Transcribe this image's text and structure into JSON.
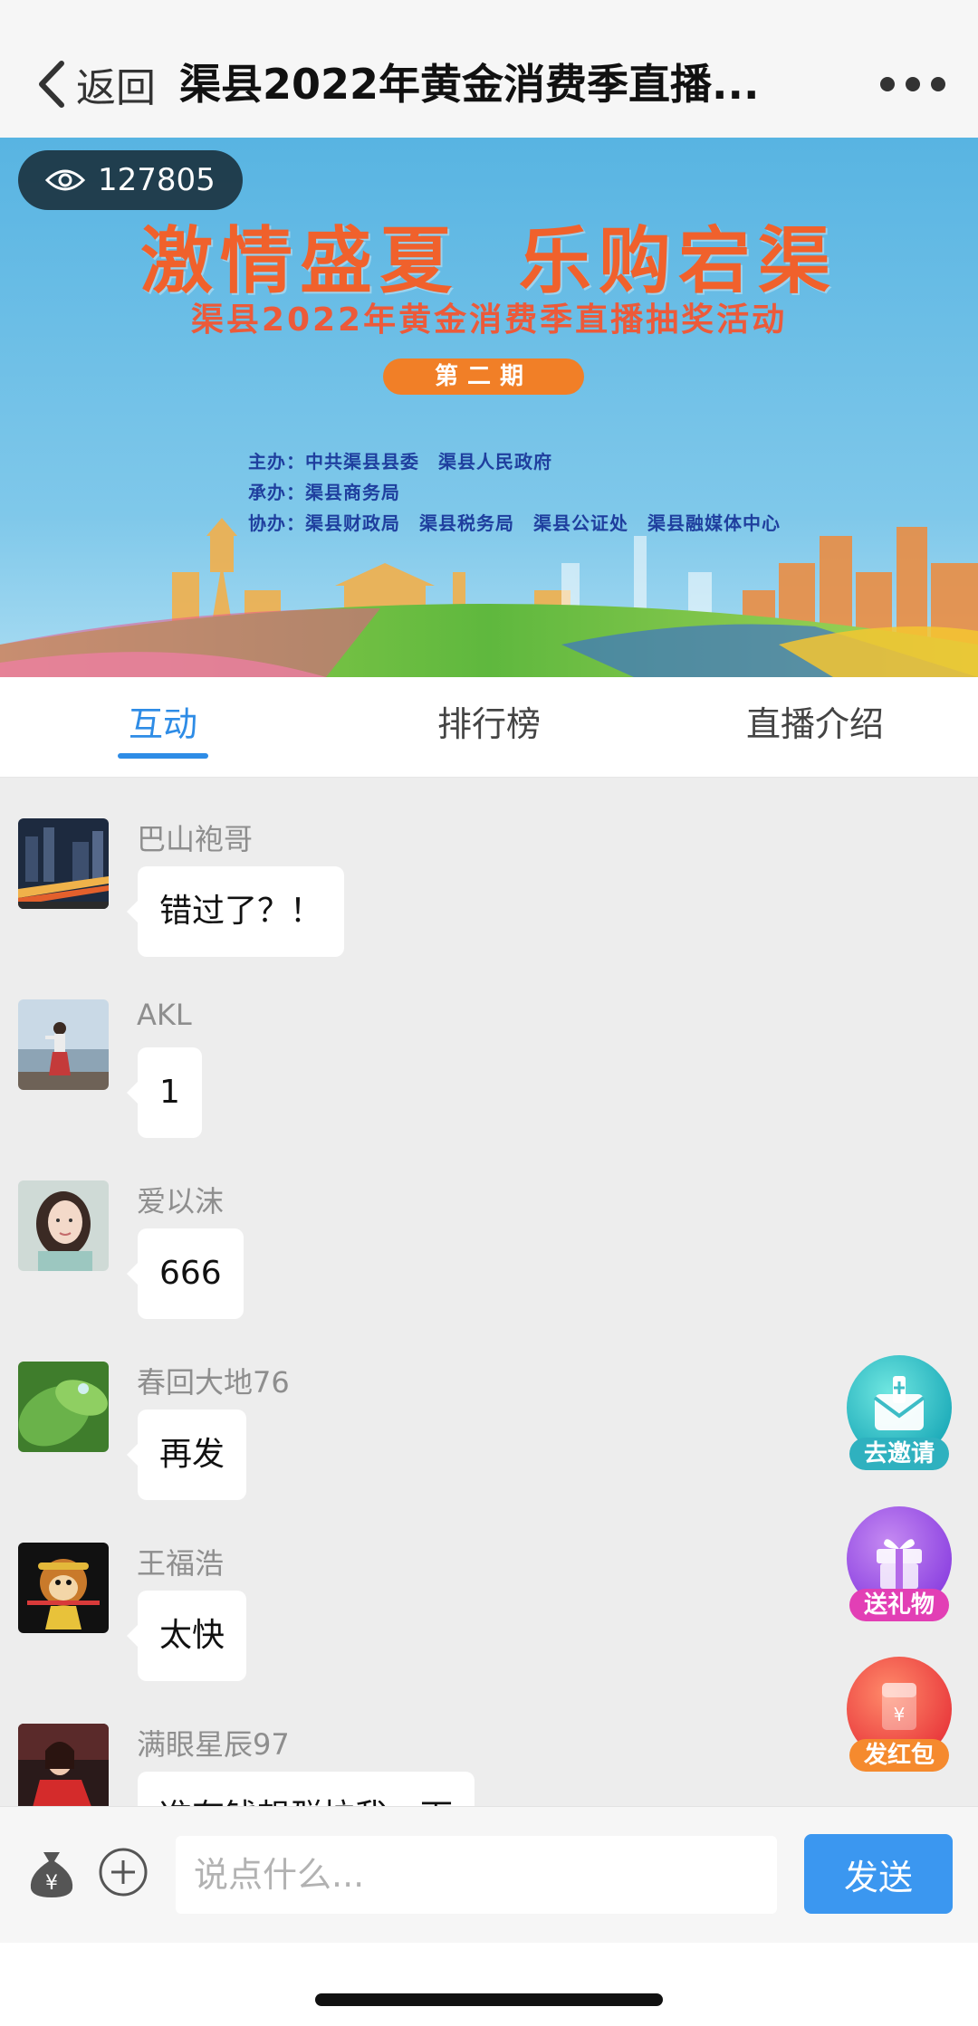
{
  "nav": {
    "back_label": "返回",
    "title": "渠县2022年黄金消费季直播..."
  },
  "banner": {
    "view_count": "127805",
    "headline": "激情盛夏 乐购宕渠",
    "subtitle": "渠县2022年黄金消费季直播抽奖活动",
    "period": "第二期",
    "organizers": [
      "主办：中共渠县县委　渠县人民政府",
      "承办：渠县商务局",
      "协办：渠县财政局　渠县税务局　渠县公证处　渠县融媒体中心"
    ]
  },
  "tabs": [
    {
      "label": "互动",
      "active": true
    },
    {
      "label": "排行榜",
      "active": false
    },
    {
      "label": "直播介绍",
      "active": false
    }
  ],
  "messages": [
    {
      "name": "巴山袍哥",
      "text": "错过了？！",
      "avatar": "city-night-avatar"
    },
    {
      "name": "AKL",
      "text": "1",
      "avatar": "seaside-person-avatar"
    },
    {
      "name": "爱以沫",
      "text": "666",
      "avatar": "girl-portrait-avatar"
    },
    {
      "name": "春回大地76",
      "text": "再发",
      "avatar": "green-leaf-avatar"
    },
    {
      "name": "王福浩",
      "text": "太快",
      "avatar": "cartoon-monkey-avatar"
    },
    {
      "name": "满眼星辰97",
      "text": "准有钱想群拉我一下",
      "avatar": "red-dress-avatar"
    }
  ],
  "actions": {
    "invite_label": "去邀请",
    "gift_label": "送礼物",
    "redpacket_label": "发红包"
  },
  "input": {
    "placeholder": "说点什么...",
    "send_label": "发送"
  },
  "colors": {
    "accent": "#2e8ce6",
    "send_button": "#3b97f0",
    "chat_background": "#ededed",
    "headline": "#f0612c"
  }
}
